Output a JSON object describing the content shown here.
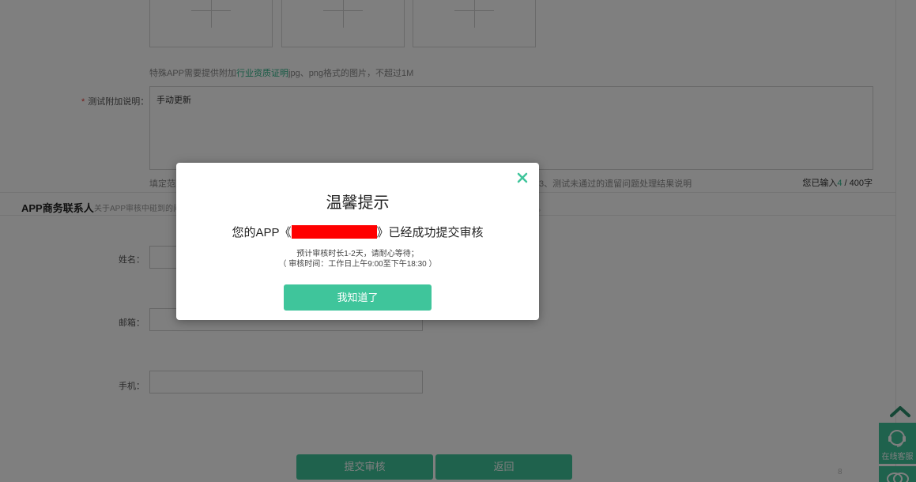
{
  "form": {
    "upload_hint_prefix": "特殊APP需要提供附加",
    "upload_hint_link": "行业资质证明",
    "upload_hint_suffix": "jpg、png格式的图片，不超过1M",
    "test_note_required": "*",
    "test_note_label": "测试附加说明：",
    "test_note_value": "手动更新",
    "test_note_hint_left": "填定范围",
    "test_note_hint_right": "3、测试未通过的遗留问题处理结果说明",
    "counter_prefix": "您已输入",
    "counter_value": "4",
    "counter_suffix": " / 400字"
  },
  "contact_section": {
    "title": "APP商务联系人",
    "subtitle": "关于APP审核中碰到的问",
    "subtitle_end": "。",
    "name_label": "姓名：",
    "email_label": "邮箱：",
    "phone_label": "手机："
  },
  "bottom_buttons": {
    "submit_label": "提交审核",
    "back_label": "返回"
  },
  "side_tools": {
    "online_service_label": "在线客服",
    "page_indicator": "8"
  },
  "modal": {
    "title": "温馨提示",
    "message_prefix": "您的APP《",
    "message_suffix": "》已经成功提交审核",
    "note_line1": "预计审核时长1-2天，请耐心等待；",
    "note_line2": "（ 审核时间：工作日上午9:00至下午18:30 ）",
    "confirm_label": "我知道了"
  },
  "colors": {
    "accent": "#3fc59b",
    "redaction": "#ff0000",
    "required": "#e53935"
  }
}
